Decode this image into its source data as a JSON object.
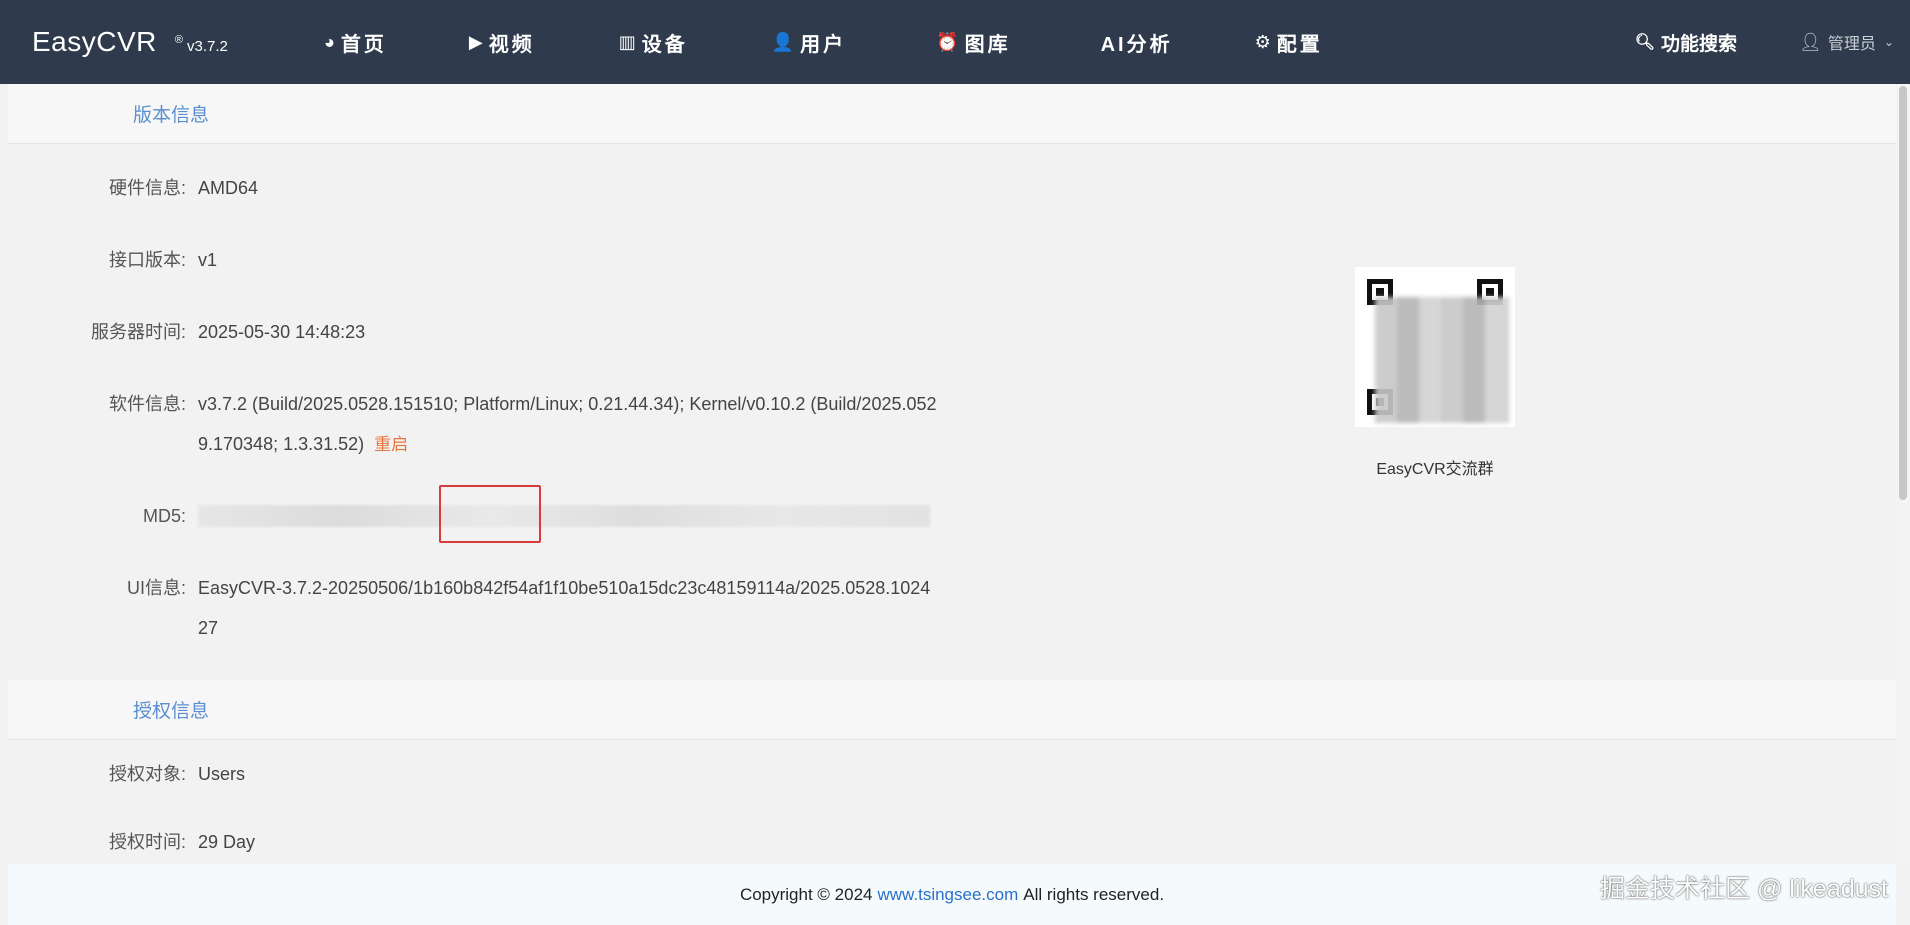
{
  "navbar": {
    "brand": "EasyCVR",
    "badge": "®",
    "version": "v3.7.2",
    "items": [
      {
        "label": "首页",
        "icon": "dashboard-icon",
        "glyph": "◕"
      },
      {
        "label": "视频",
        "icon": "play-circle-icon",
        "glyph": "▶"
      },
      {
        "label": "设备",
        "icon": "device-icon",
        "glyph": "▥"
      },
      {
        "label": "用户",
        "icon": "user-icon",
        "glyph": "👤"
      },
      {
        "label": "图库",
        "icon": "alarm-icon",
        "glyph": "⏰"
      },
      {
        "label": "AI分析",
        "icon": "",
        "glyph": ""
      },
      {
        "label": "配置",
        "icon": "gear-icon",
        "glyph": "⚙"
      }
    ],
    "search_label": "功能搜索",
    "user_label": "管理员"
  },
  "version_section": {
    "title": "版本信息",
    "rows": [
      {
        "label": "硬件信息:",
        "value": "AMD64"
      },
      {
        "label": "接口版本:",
        "value": "v1"
      },
      {
        "label": "服务器时间:",
        "value": "2025-05-30 14:48:23"
      },
      {
        "label": "软件信息:",
        "value": "v3.7.2 (Build/2025.0528.151510; Platform/Linux; 0.21.44.34); Kernel/v0.10.2 (Build/2025.0529.170348; 1.3.31.52)"
      },
      {
        "label": "MD5:",
        "value": ""
      },
      {
        "label": "UI信息:",
        "value": "EasyCVR-3.7.2-20250506/1b160b842f54af1f10be510a15dc23c48159114a/2025.0528.102427"
      }
    ],
    "restart_label": "重启",
    "qr_caption": "EasyCVR交流群"
  },
  "license_section": {
    "title": "授权信息",
    "rows": [
      {
        "label": "授权对象:",
        "value": "Users"
      },
      {
        "label": "授权时间:",
        "value": "29 Day"
      }
    ]
  },
  "footer": {
    "prefix": "Copyright © 2024",
    "link": "www.tsingsee.com",
    "suffix": "All rights reserved."
  },
  "watermark": "掘金技术社区 @ likeadust",
  "colors": {
    "navbar_bg": "#2f3b4c",
    "section_title": "#5a8fd1",
    "restart": "#e6763f",
    "highlight_box": "#d93a3a",
    "link": "#2a6fc9"
  }
}
